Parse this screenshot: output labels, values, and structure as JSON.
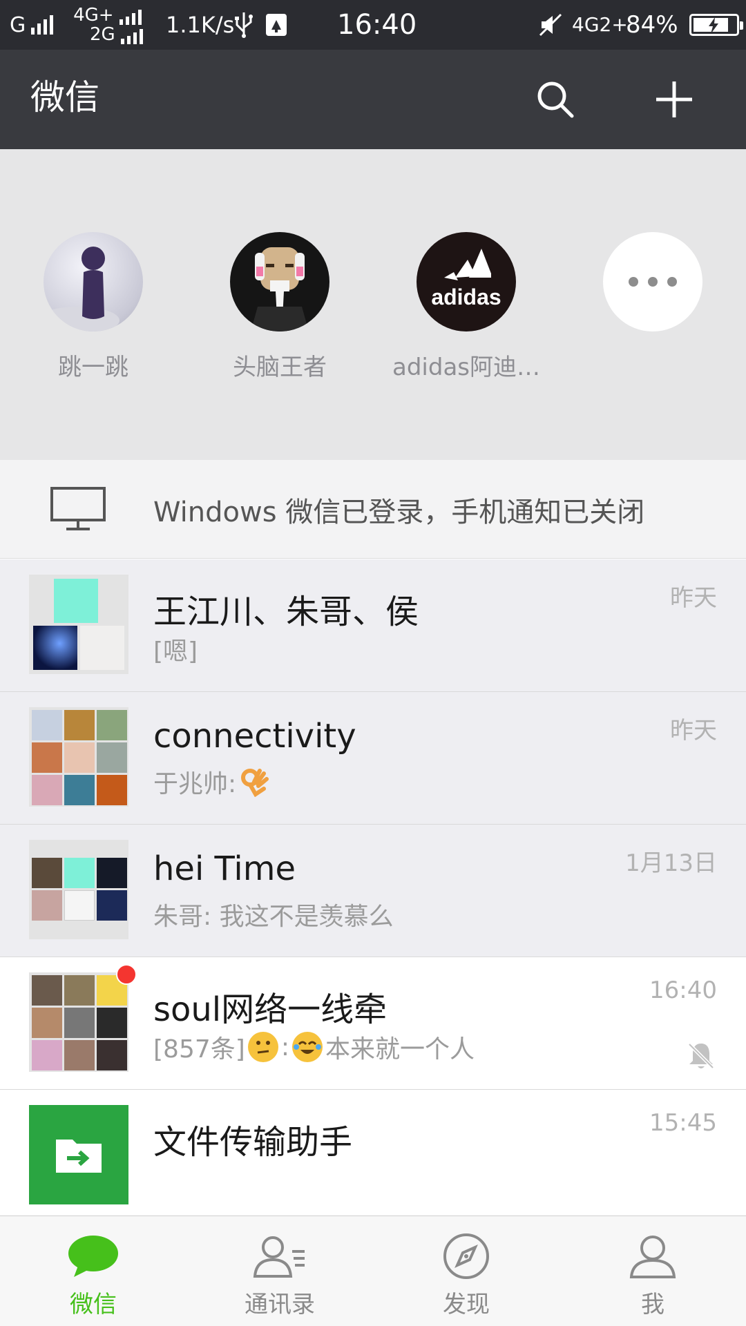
{
  "status_bar": {
    "carrier1": "G",
    "net_top": "4G+",
    "net_bottom": "2G",
    "speed": "1.1K/s",
    "time": "16:40",
    "net_right": "4G2+",
    "battery_percent": "84%",
    "battery_level": 0.84,
    "icons": [
      "usb-icon",
      "clean-icon",
      "mute-vibrate-icon",
      "battery-icon"
    ]
  },
  "header": {
    "title": "微信",
    "search_icon": "search-icon",
    "add_icon": "plus-icon"
  },
  "mini_programs": [
    {
      "name": "跳一跳",
      "icon": "jump-game-icon"
    },
    {
      "name": "头脑王者",
      "icon": "brain-king-icon"
    },
    {
      "name": "adidas阿迪…",
      "icon": "adidas-logo-icon",
      "logo_text": "adidas"
    },
    {
      "name": "",
      "icon": "more-dots-icon"
    }
  ],
  "notice": {
    "text": "Windows 微信已登录，手机通知已关闭",
    "icon": "monitor-icon"
  },
  "chats": [
    {
      "name": "王江川、朱哥、侯",
      "preview": "[嗯]",
      "time": "昨天",
      "pinned": true
    },
    {
      "name": "connectivity",
      "preview": "于兆帅: ",
      "preview_emoji": "ok-hand-emoji",
      "time": "昨天",
      "pinned": true
    },
    {
      "name": "hei Time",
      "preview": "朱哥: 我这不是羡慕么",
      "time": "1月13日",
      "pinned": true
    },
    {
      "name": "soul网络一线牵",
      "preview_prefix": "[857条] ",
      "preview_sep": ": ",
      "preview_text": "本来就一个人",
      "time": "16:40",
      "pinned": false,
      "unread_dot": true,
      "muted": true
    },
    {
      "name": "文件传输助手",
      "preview": "",
      "time": "15:45",
      "pinned": false
    }
  ],
  "tabs": [
    {
      "label": "微信",
      "icon": "chat-bubble-icon",
      "active": true
    },
    {
      "label": "通讯录",
      "icon": "contacts-icon",
      "active": false
    },
    {
      "label": "发现",
      "icon": "compass-icon",
      "active": false
    },
    {
      "label": "我",
      "icon": "person-icon",
      "active": false
    }
  ],
  "colors": {
    "accent_green": "#46c01b",
    "title_bar": "#393a3f",
    "status_bar": "#2b2c31",
    "unread_red": "#f43530",
    "file_helper_green": "#2aa541"
  }
}
